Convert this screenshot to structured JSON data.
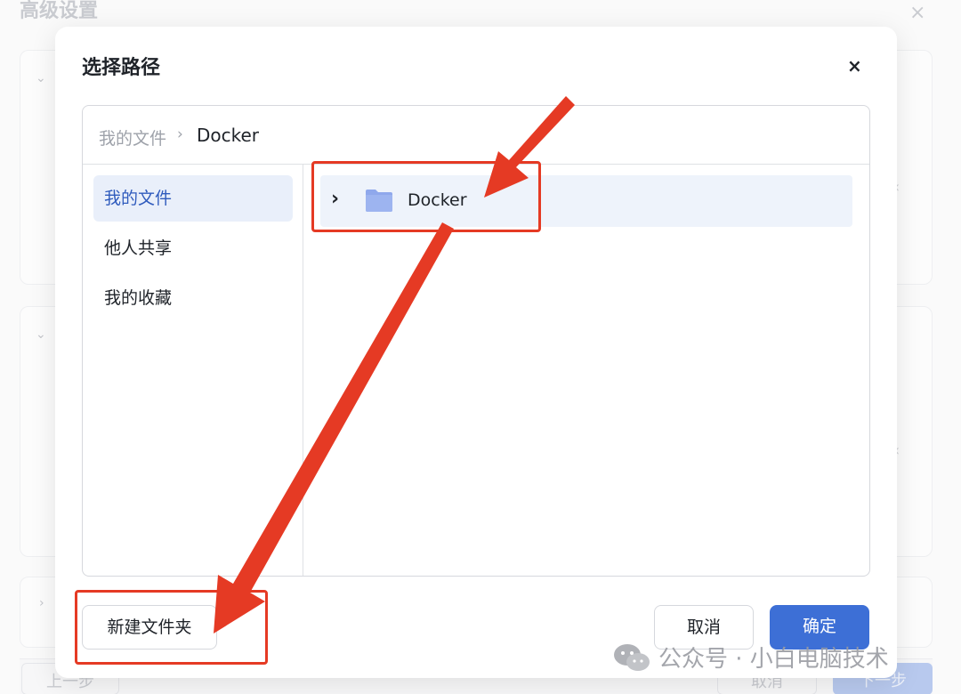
{
  "background": {
    "title": "高级设置",
    "close_glyph": "×",
    "prev_label": "上一步",
    "cancel_label": "取消",
    "next_label": "下一步"
  },
  "dialog": {
    "title": "选择路径",
    "close_glyph": "×",
    "breadcrumb": {
      "root": "我的文件",
      "separator": "›",
      "current": "Docker"
    },
    "sidebar": {
      "items": [
        {
          "label": "我的文件",
          "active": true
        },
        {
          "label": "他人共享",
          "active": false
        },
        {
          "label": "我的收藏",
          "active": false
        }
      ]
    },
    "files": [
      {
        "name": "Docker",
        "icon": "folder-icon",
        "expand_glyph": "›"
      }
    ],
    "buttons": {
      "new_folder": "新建文件夹",
      "cancel": "取消",
      "confirm": "确定"
    }
  },
  "annotations": {
    "color": "#e53a24"
  },
  "watermark": {
    "text": "公众号 · 小白电脑技术",
    "icon": "wechat-icon"
  },
  "colors": {
    "accent": "#3d6fd6",
    "active_bg": "#e9effa",
    "folder": "#8fa8ec"
  }
}
